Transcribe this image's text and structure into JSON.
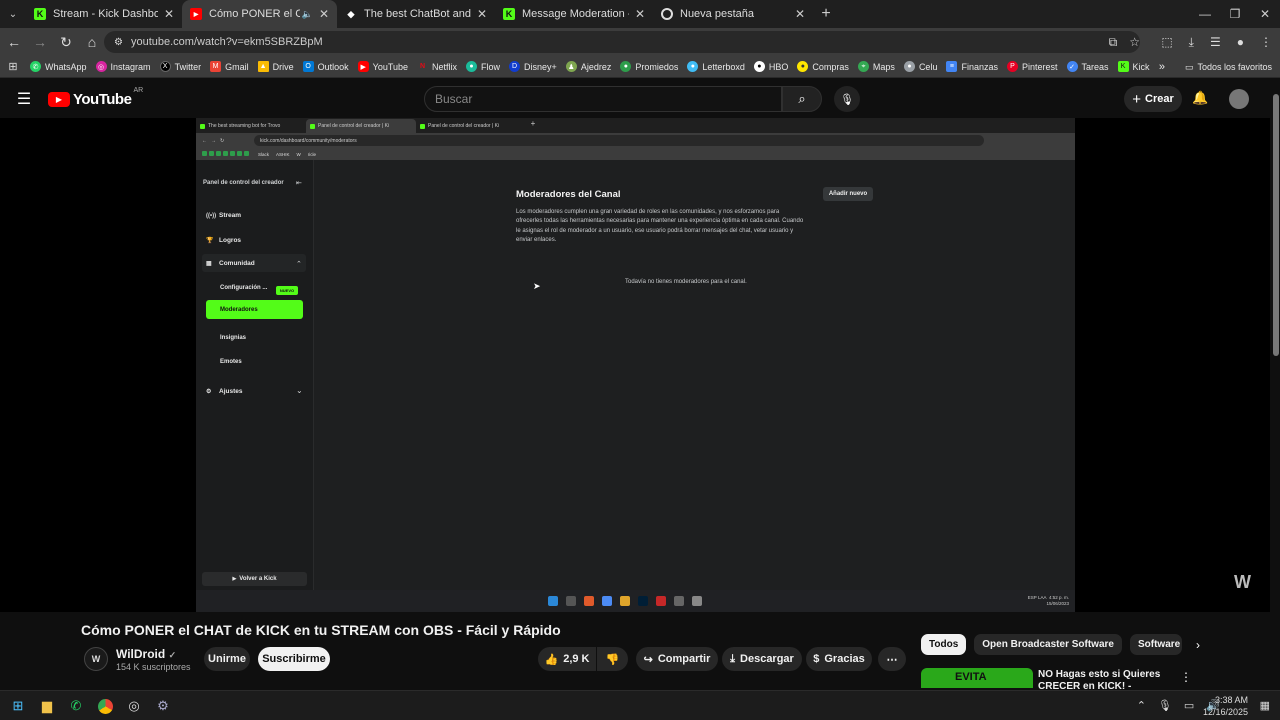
{
  "browser": {
    "tabs": [
      {
        "title": "Stream - Kick Dashboard",
        "favicon": "kick-icon",
        "active": false
      },
      {
        "title": "Cómo PONER el CHAT de K",
        "favicon": "youtube-icon",
        "active": true
      },
      {
        "title": "The best ChatBot and Widgets",
        "favicon": "diamond-icon",
        "active": false
      },
      {
        "title": "Message Moderation - Kick Da",
        "favicon": "kick-icon",
        "active": false
      },
      {
        "title": "Nueva pestaña",
        "favicon": "chrome-icon",
        "active": false
      }
    ],
    "url": "youtube.com/watch?v=ekm5SBRZBpM",
    "bookmarks": [
      "WhatsApp",
      "Instagram",
      "Twitter",
      "Gmail",
      "Drive",
      "Outlook",
      "YouTube",
      "Netflix",
      "Flow",
      "Disney+",
      "Ajedrez",
      "Promiedos",
      "Letterboxd",
      "HBO",
      "Compras",
      "Maps",
      "Celu",
      "Finanzas",
      "Pinterest",
      "Tareas",
      "Kick"
    ],
    "bookmarks_folder": "Todos los favoritos"
  },
  "youtube": {
    "logo": "YouTube",
    "region": "AR",
    "search_placeholder": "Buscar",
    "create_label": "Crear"
  },
  "embedded": {
    "tabs": [
      "The best streaming bot for Trovo",
      "Panel de control del creador | Ki",
      "Panel de control del creador | Ki"
    ],
    "url": "kick.com/dashboard/community/moderators",
    "bookmarks": [
      "Slack",
      "ASHIK",
      "W",
      "ricle"
    ],
    "sidebar_title": "Panel de control del creador",
    "items": {
      "stream": "Stream",
      "logros": "Logros",
      "comunidad": "Comunidad",
      "configuracion": "Configuración ...",
      "nuevo": "NUEVO",
      "moderadores": "Moderadores",
      "insignias": "Insignias",
      "emotes": "Emotes",
      "ajustes": "Ajustes"
    },
    "back_label": "Volver a Kick",
    "heading": "Moderadores del Canal",
    "add_button": "Añadir nuevo",
    "description": "Los moderadores cumplen una gran variedad de roles en las comunidades, y nos esforzamos para ofrecerles todas las herramientas necesarias para mantener una experiencia óptima en cada canal. Cuando le asignas el rol de moderador a un usuario, ese usuario podrá borrar mensajes del chat, vetar usuario y enviar enlaces.",
    "empty_message": "Todavía no tienes moderadores para el canal.",
    "tray_lang": "ESP LAA",
    "tray_time": "4:52 p. m.",
    "tray_date": "15/06/2023"
  },
  "video": {
    "title": "Cómo PONER el CHAT de KICK en tu STREAM con OBS - Fácil y Rápido",
    "channel": "WilDroid",
    "subscribers": "154 K suscriptores",
    "join_label": "Unirme",
    "subscribe_label": "Suscribirme",
    "likes": "2,9 K",
    "share_label": "Compartir",
    "download_label": "Descargar",
    "thanks_label": "Gracias"
  },
  "related": {
    "chips": [
      "Todos",
      "Open Broadcaster Software",
      "Software"
    ],
    "first_title": "NO Hagas esto si Quieres CRECER en KICK! - Errores m",
    "first_thumb_text": "EVITA"
  },
  "taskbar": {
    "time": "3:38 AM",
    "date": "12/16/2025"
  }
}
